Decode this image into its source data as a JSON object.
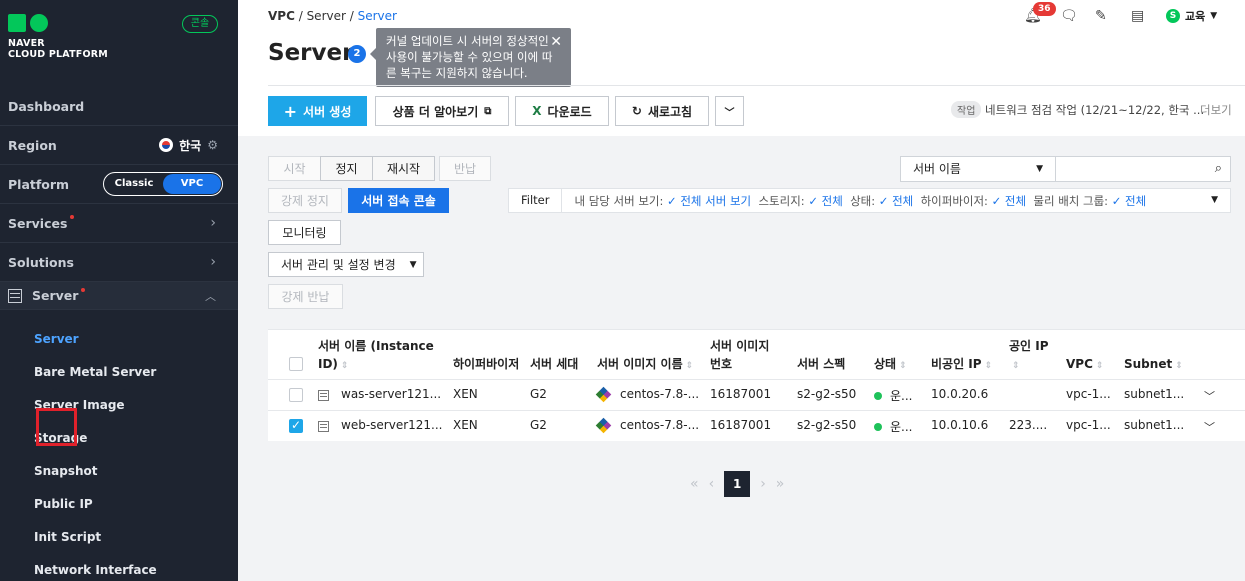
{
  "sidebar": {
    "logo_line1": "NAVER",
    "logo_line2": "CLOUD PLATFORM",
    "console_badge": "콘솔",
    "dashboard": "Dashboard",
    "region_label": "Region",
    "region_value": "한국",
    "platform_label": "Platform",
    "platform_options": [
      "Classic",
      "VPC"
    ],
    "platform_selected": "VPC",
    "services": "Services",
    "solutions": "Solutions",
    "server": "Server",
    "submenu": [
      "Server",
      "Bare Metal Server",
      "Server Image",
      "Storage",
      "Snapshot",
      "Public IP",
      "Init Script",
      "Network Interface"
    ],
    "active_submenu": "Server"
  },
  "header": {
    "breadcrumb": [
      "VPC",
      "Server",
      "Server"
    ],
    "title": "Server",
    "count": "2",
    "tooltip": "커널 업데이트 시 서버의 정상적인 사용이 불가능할 수 있으며 이에 따른 복구는 지원하지 않습니다.",
    "notification_count": "36",
    "user_initial": "S",
    "user_name": "교육"
  },
  "toolbar": {
    "create": "서버 생성",
    "learn_more": "상품 더 알아보기",
    "download": "다운로드",
    "refresh": "새로고침",
    "work_tag": "작업",
    "work_text": "네트워크 점검 작업 (12/21~12/22, 한국 ...",
    "more": "더보기"
  },
  "actions": {
    "start": "시작",
    "stop": "정지",
    "restart": "재시작",
    "return": "반납",
    "force_stop": "강제 정지",
    "console_access": "서버 접속 콘솔",
    "monitoring": "모니터링",
    "manage_settings": "서버 관리 및 설정 변경",
    "force_return": "강제 반납"
  },
  "search": {
    "select_value": "서버 이름",
    "input_value": ""
  },
  "filter": {
    "label": "Filter",
    "items": [
      {
        "name": "내 담당 서버 보기:",
        "value": "전체 서버 보기"
      },
      {
        "name": "스토리지:",
        "value": "전체"
      },
      {
        "name": "상태:",
        "value": "전체"
      },
      {
        "name": "하이퍼바이저:",
        "value": "전체"
      },
      {
        "name": "물리 배치 그룹:",
        "value": "전체"
      }
    ]
  },
  "table": {
    "headers": {
      "name_line1": "서버 이름 (Instance",
      "name_line2": "ID)",
      "hypervisor": "하이퍼바이저",
      "generation": "서버 세대",
      "image_name": "서버 이미지 이름",
      "image_no_line1": "서버 이미지",
      "image_no_line2": "번호",
      "spec": "서버 스펙",
      "status": "상태",
      "private_ip": "비공인 IP",
      "public_ip": "공인 IP",
      "vpc": "VPC",
      "subnet": "Subnet"
    },
    "rows": [
      {
        "checked": false,
        "name": "was-server121...",
        "hypervisor": "XEN",
        "generation": "G2",
        "image": "centos-7.8-...",
        "image_no": "16187001",
        "spec": "s2-g2-s50",
        "status": "운...",
        "private_ip": "10.0.20.6",
        "public_ip": "",
        "vpc": "vpc-1...",
        "subnet": "subnet1..."
      },
      {
        "checked": true,
        "name": "web-server121...",
        "hypervisor": "XEN",
        "generation": "G2",
        "image": "centos-7.8-...",
        "image_no": "16187001",
        "spec": "s2-g2-s50",
        "status": "운...",
        "private_ip": "10.0.10.6",
        "public_ip": "223....",
        "vpc": "vpc-1...",
        "subnet": "subnet1..."
      }
    ]
  },
  "pagination": {
    "current_page": "1"
  }
}
